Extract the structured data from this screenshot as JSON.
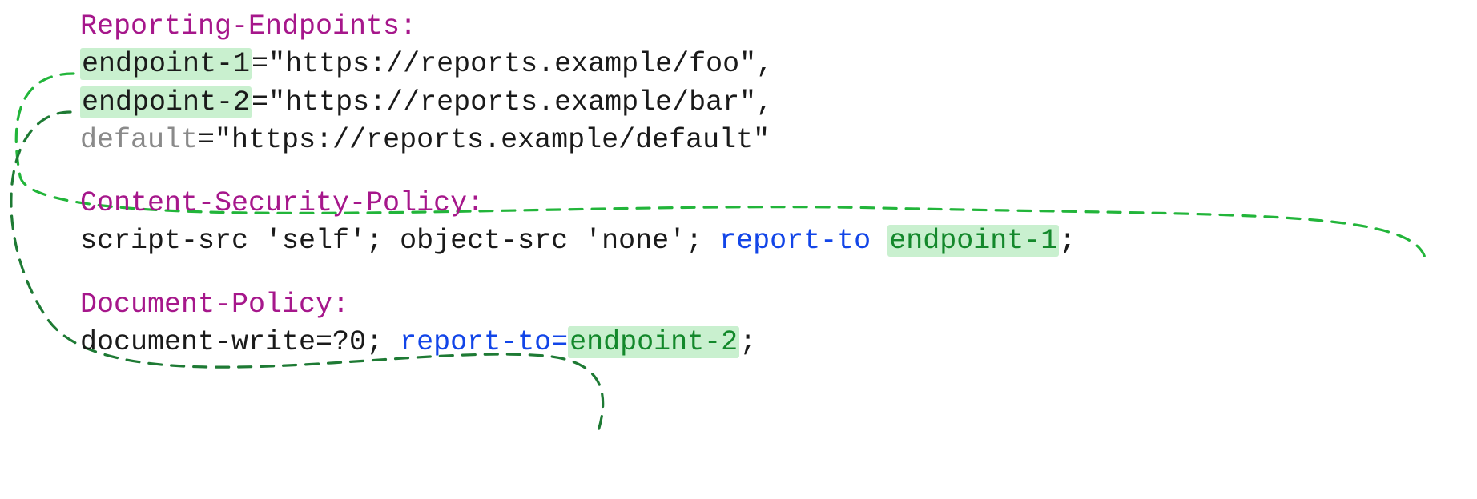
{
  "headers": {
    "reporting": {
      "name": "Reporting-Endpoints:",
      "entries": [
        {
          "label": "endpoint-1",
          "eq": "=",
          "url": "\"https://reports.example/foo\"",
          "trail": ","
        },
        {
          "label": "endpoint-2",
          "eq": "=",
          "url": "\"https://reports.example/bar\"",
          "trail": ","
        },
        {
          "label": "default",
          "eq": "=",
          "url": "\"https://reports.example/default\"",
          "trail": ""
        }
      ]
    },
    "csp": {
      "name": "Content-Security-Policy:",
      "body_pre": "script-src 'self'; object-src 'none'; ",
      "report_to": "report-to",
      "space": " ",
      "endpoint": "endpoint-1",
      "trail": ";"
    },
    "docpolicy": {
      "name": "Document-Policy:",
      "body_pre": "document-write=?0; ",
      "report_to": "report-to=",
      "endpoint": "endpoint-2",
      "trail": ";"
    }
  }
}
